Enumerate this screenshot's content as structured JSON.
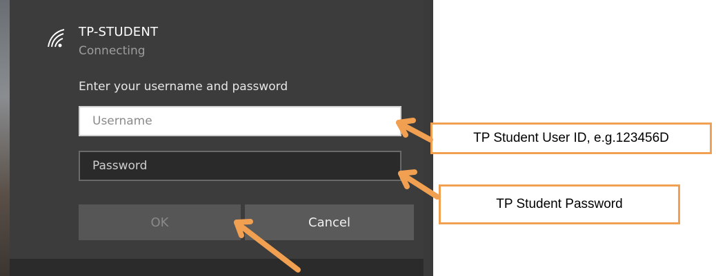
{
  "network": {
    "name": "TP-STUDENT",
    "status": "Connecting",
    "icon": "wifi-icon"
  },
  "credentials": {
    "prompt": "Enter your username and password",
    "username_placeholder": "Username",
    "password_placeholder": "Password"
  },
  "buttons": {
    "ok": "OK",
    "cancel": "Cancel"
  },
  "callouts": {
    "user_id": "TP Student User ID, e.g.123456D",
    "password": "TP Student Password"
  },
  "colors": {
    "callout_accent": "#f0a050",
    "flyout_background": "#3c3c3c"
  }
}
